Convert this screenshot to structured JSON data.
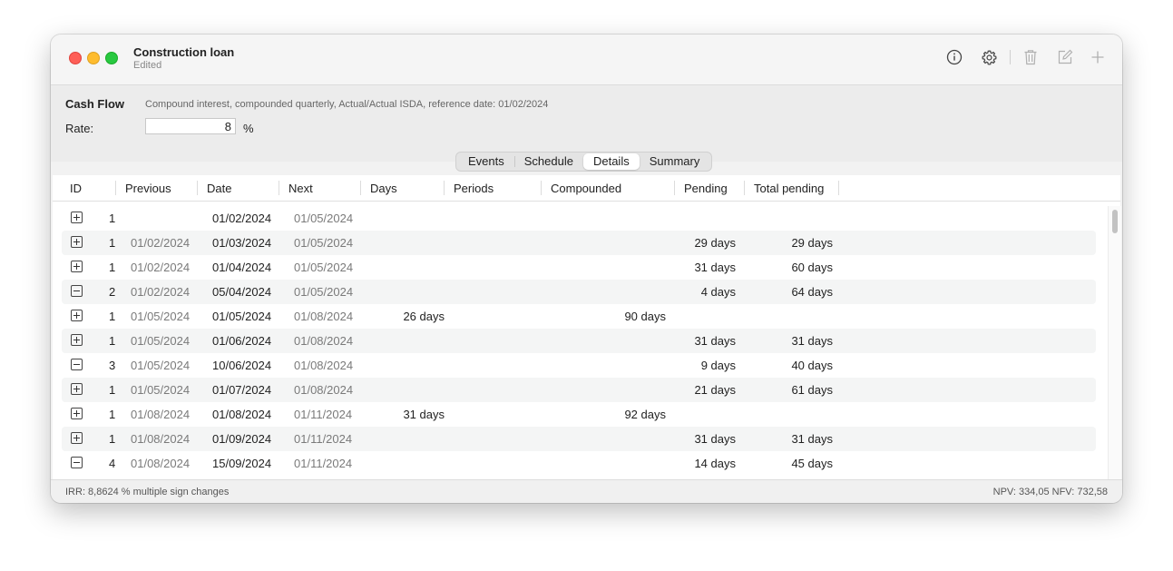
{
  "window": {
    "title": "Construction loan",
    "subtitle": "Edited"
  },
  "toolbar": {
    "icons": [
      "info-icon",
      "gear-icon",
      "trash-icon",
      "compose-icon",
      "plus-icon"
    ]
  },
  "cashflow": {
    "title": "Cash Flow",
    "description": "Compound interest, compounded quarterly, Actual/Actual ISDA, reference date: 01/02/2024",
    "rate_label": "Rate:",
    "rate_value": "8",
    "rate_unit": "%"
  },
  "tabs": [
    {
      "label": "Events",
      "active": false
    },
    {
      "label": "Schedule",
      "active": false
    },
    {
      "label": "Details",
      "active": true
    },
    {
      "label": "Summary",
      "active": false
    }
  ],
  "table": {
    "columns": [
      "ID",
      "Previous",
      "Date",
      "Next",
      "Days",
      "Periods",
      "Compounded",
      "Pending",
      "Total pending"
    ],
    "rows": [
      {
        "expander": "plus",
        "id": "1",
        "previous": "",
        "date": "01/02/2024",
        "next": "01/05/2024",
        "days": "",
        "compounded": "",
        "pending": "",
        "total_pending": ""
      },
      {
        "expander": "plus",
        "id": "1",
        "previous": "01/02/2024",
        "date": "01/03/2024",
        "next": "01/05/2024",
        "days": "",
        "compounded": "",
        "pending": "29 days",
        "total_pending": "29 days"
      },
      {
        "expander": "plus",
        "id": "1",
        "previous": "01/02/2024",
        "date": "01/04/2024",
        "next": "01/05/2024",
        "days": "",
        "compounded": "",
        "pending": "31 days",
        "total_pending": "60 days"
      },
      {
        "expander": "minus",
        "id": "2",
        "previous": "01/02/2024",
        "date": "05/04/2024",
        "next": "01/05/2024",
        "days": "",
        "compounded": "",
        "pending": "4 days",
        "total_pending": "64 days"
      },
      {
        "expander": "plus",
        "id": "1",
        "previous": "01/05/2024",
        "date": "01/05/2024",
        "next": "01/08/2024",
        "days": "26 days",
        "compounded": "90 days",
        "pending": "",
        "total_pending": ""
      },
      {
        "expander": "plus",
        "id": "1",
        "previous": "01/05/2024",
        "date": "01/06/2024",
        "next": "01/08/2024",
        "days": "",
        "compounded": "",
        "pending": "31 days",
        "total_pending": "31 days"
      },
      {
        "expander": "minus",
        "id": "3",
        "previous": "01/05/2024",
        "date": "10/06/2024",
        "next": "01/08/2024",
        "days": "",
        "compounded": "",
        "pending": "9 days",
        "total_pending": "40 days"
      },
      {
        "expander": "plus",
        "id": "1",
        "previous": "01/05/2024",
        "date": "01/07/2024",
        "next": "01/08/2024",
        "days": "",
        "compounded": "",
        "pending": "21 days",
        "total_pending": "61 days"
      },
      {
        "expander": "plus",
        "id": "1",
        "previous": "01/08/2024",
        "date": "01/08/2024",
        "next": "01/11/2024",
        "days": "31 days",
        "compounded": "92 days",
        "pending": "",
        "total_pending": ""
      },
      {
        "expander": "plus",
        "id": "1",
        "previous": "01/08/2024",
        "date": "01/09/2024",
        "next": "01/11/2024",
        "days": "",
        "compounded": "",
        "pending": "31 days",
        "total_pending": "31 days"
      },
      {
        "expander": "minus",
        "id": "4",
        "previous": "01/08/2024",
        "date": "15/09/2024",
        "next": "01/11/2024",
        "days": "",
        "compounded": "",
        "pending": "14 days",
        "total_pending": "45 days"
      }
    ]
  },
  "status": {
    "left": "IRR: 8,8624 %   multiple sign changes",
    "right": "NPV:  334,05   NFV:  732,58"
  },
  "colors": {
    "close": "#fe5f57",
    "minimize": "#febc2e",
    "zoom": "#28c840",
    "row_alt": "#f4f5f5"
  }
}
